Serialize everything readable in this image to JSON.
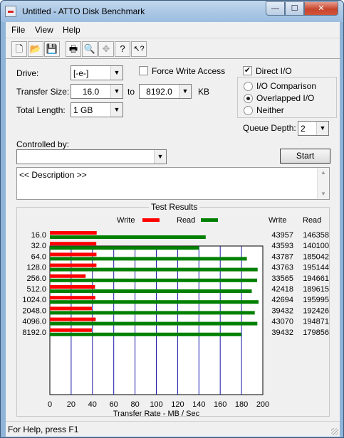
{
  "window": {
    "title": "Untitled - ATTO Disk Benchmark",
    "min_glyph": "—",
    "max_glyph": "☐",
    "close_glyph": "✕"
  },
  "menu": [
    "File",
    "View",
    "Help"
  ],
  "toolbar": [
    {
      "name": "new-icon",
      "glyph": "🗋",
      "enabled": true
    },
    {
      "name": "open-icon",
      "glyph": "📂",
      "enabled": true
    },
    {
      "name": "save-icon",
      "glyph": "💾",
      "enabled": true
    },
    {
      "name": "print-icon",
      "glyph": "🖶",
      "enabled": true
    },
    {
      "name": "print-preview-icon",
      "glyph": "🔍",
      "enabled": true
    },
    {
      "name": "move-icon",
      "glyph": "✥",
      "enabled": false
    },
    {
      "name": "help-icon",
      "glyph": "?",
      "enabled": true
    },
    {
      "name": "context-help-icon",
      "glyph": "↖?",
      "enabled": true
    }
  ],
  "form": {
    "drive_label": "Drive:",
    "drive_value": "[-e-]",
    "force_write_label": "Force Write Access",
    "force_write_checked": false,
    "transfer_size_label": "Transfer Size:",
    "transfer_from": "16.0",
    "to_label": "to",
    "transfer_to": "8192.0",
    "kb_label": "KB",
    "total_length_label": "Total Length:",
    "total_length_value": "1 GB",
    "direct_io_label": "Direct I/O",
    "direct_io_checked": true,
    "io_options": [
      {
        "label": "I/O Comparison",
        "selected": false
      },
      {
        "label": "Overlapped I/O",
        "selected": true
      },
      {
        "label": "Neither",
        "selected": false
      }
    ],
    "queue_depth_label": "Queue Depth:",
    "queue_depth_value": "2",
    "controlled_by_label": "Controlled by:",
    "controlled_by_value": "",
    "start_label": "Start",
    "description_text": "<< Description >>"
  },
  "results": {
    "group_title": "Test Results"
  },
  "chart_data": {
    "type": "bar",
    "orientation": "horizontal",
    "categories": [
      "16.0",
      "32.0",
      "64.0",
      "128.0",
      "256.0",
      "512.0",
      "1024.0",
      "2048.0",
      "4096.0",
      "8192.0"
    ],
    "series": [
      {
        "name": "Write",
        "color": "#ff0000",
        "values": [
          43957,
          43593,
          43787,
          43763,
          33565,
          42418,
          42694,
          39432,
          43070,
          39432
        ]
      },
      {
        "name": "Read",
        "color": "#008000",
        "values": [
          146358,
          140100,
          185042,
          195144,
          194661,
          189615,
          195995,
          192426,
          194871,
          179856
        ]
      }
    ],
    "value_unit_divisor": 1000,
    "xlabel": "Transfer Rate - MB / Sec",
    "xlim": [
      0,
      200
    ],
    "xticks": [
      "0",
      "20",
      "40",
      "60",
      "80",
      "100",
      "120",
      "140",
      "160",
      "180",
      "200"
    ],
    "column_headers": [
      "Write",
      "Read"
    ],
    "legend_placement": "top",
    "grid": true
  },
  "statusbar": {
    "text": "For Help, press F1"
  }
}
